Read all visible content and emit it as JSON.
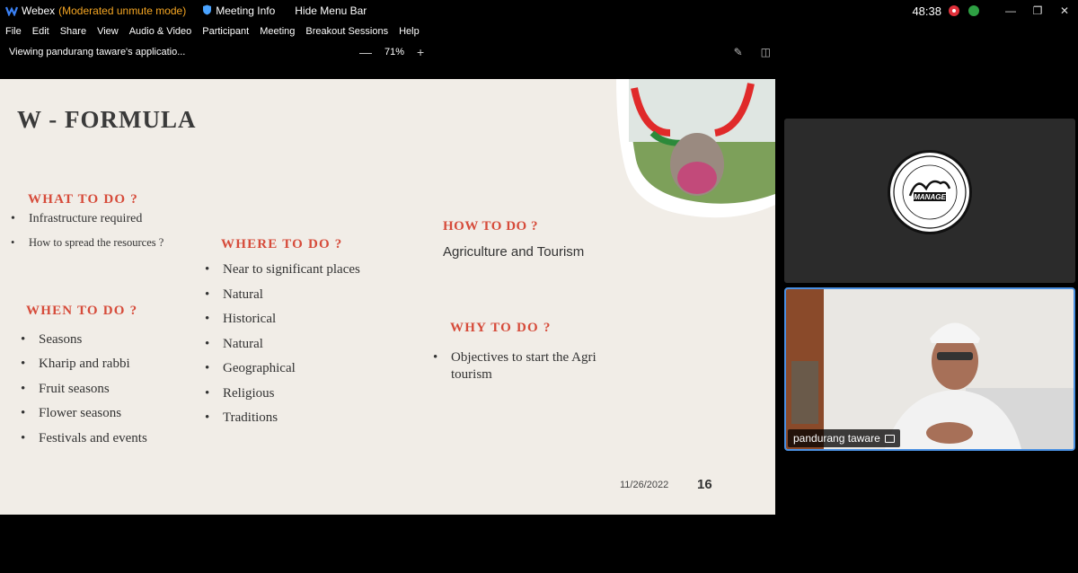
{
  "titlebar": {
    "app_name": "Webex",
    "mode": "(Moderated unmute mode)",
    "meeting_info": "Meeting Info",
    "hide_menu": "Hide Menu Bar",
    "timer": "48:38"
  },
  "menu": [
    "File",
    "Edit",
    "Share",
    "View",
    "Audio & Video",
    "Participant",
    "Meeting",
    "Breakout Sessions",
    "Help"
  ],
  "viewbar": {
    "viewing": "Viewing pandurang taware's applicatio...",
    "zoom_minus": "—",
    "zoom": "71%",
    "zoom_plus": "+"
  },
  "slide": {
    "title": "W - FORMULA",
    "what": {
      "heading": "WHAT TO DO ?",
      "items": [
        "Infrastructure required",
        "How to spread the resources ?"
      ]
    },
    "when": {
      "heading": "WHEN TO DO ?",
      "items": [
        "Seasons",
        "Kharip and rabbi",
        "Fruit seasons",
        "Flower seasons",
        "Festivals and events"
      ]
    },
    "where": {
      "heading": "WHERE TO DO ?",
      "items": [
        "Near to significant places",
        "Natural",
        "Historical",
        "Natural",
        "Geographical",
        "Religious",
        "Traditions"
      ]
    },
    "how": {
      "heading": "HOW TO DO ?",
      "text": "Agriculture and Tourism"
    },
    "why": {
      "heading": "WHY TO DO ?",
      "item_line1": "Objectives to start the Agri",
      "item_line2": "tourism"
    },
    "date": "11/26/2022",
    "page": "16"
  },
  "participant": {
    "name": "pandurang taware",
    "logo_text": "MANAGE"
  },
  "colors": {
    "accent_red": "#d64b3a",
    "mode_orange": "#f5a623",
    "active_border": "#4a90e2"
  }
}
